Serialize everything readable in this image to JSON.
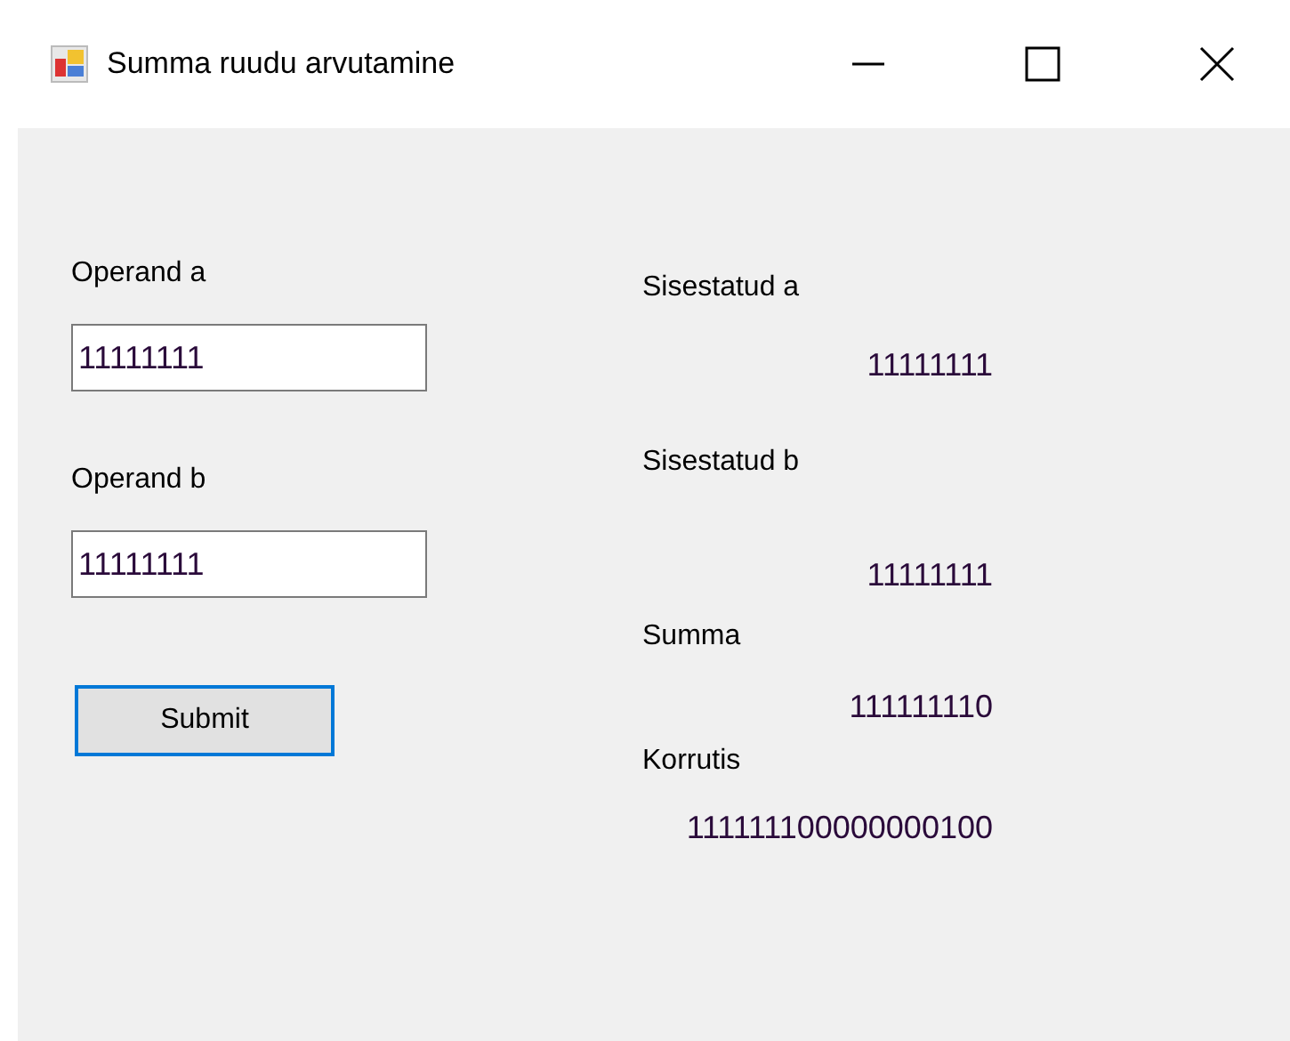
{
  "window": {
    "title": "Summa ruudu arvutamine"
  },
  "fields": [
    {
      "label": "Operand a",
      "value": "11111111"
    },
    {
      "label": "Operand b",
      "value": "11111111"
    }
  ],
  "submit": {
    "label": "Submit",
    "focused": true
  },
  "results": [
    {
      "label": "Sisestatud a",
      "value": "11111111"
    },
    {
      "label": "Sisestatud b",
      "value": "11111111"
    },
    {
      "label": "Summa",
      "value": "111111110"
    },
    {
      "label": "Korrutis",
      "value": "111111100000000100"
    }
  ]
}
